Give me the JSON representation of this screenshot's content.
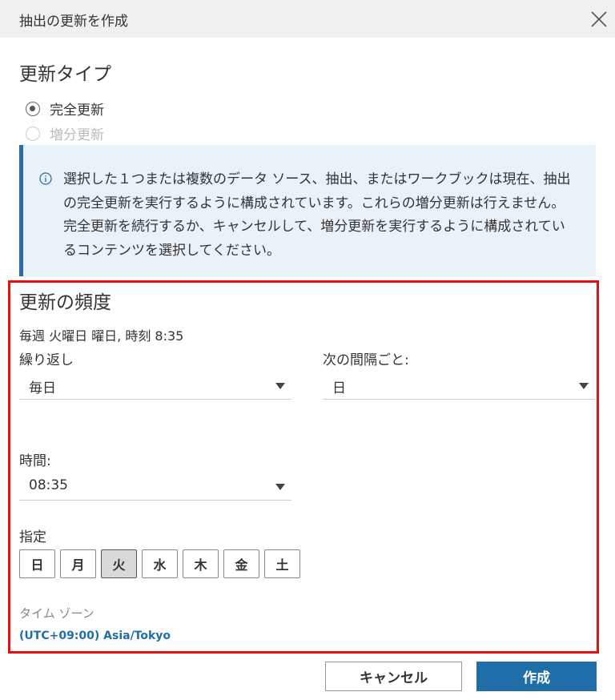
{
  "dialog": {
    "title": "抽出の更新を作成"
  },
  "refresh_type": {
    "heading": "更新タイプ",
    "options": [
      {
        "label": "完全更新",
        "selected": true,
        "enabled": true
      },
      {
        "label": "増分更新",
        "selected": false,
        "enabled": false
      }
    ]
  },
  "info_message": "選択した１つまたは複数のデータ ソース、抽出、またはワークブックは現在、抽出の完全更新を実行するように構成されています。これらの増分更新は行えません。完全更新を続行するか、キャンセルして、増分更新を実行するように構成されているコンテンツを選択してください。",
  "frequency": {
    "heading": "更新の頻度",
    "summary": "毎週 火曜日 曜日, 時刻 8:35",
    "repeat_label": "繰り返し",
    "repeat_value": "毎日",
    "interval_label": "次の間隔ごと:",
    "interval_value": "日",
    "time_label": "時間:",
    "time_value": "08:35",
    "on_label": "指定",
    "days": [
      {
        "label": "日",
        "selected": false
      },
      {
        "label": "月",
        "selected": false
      },
      {
        "label": "火",
        "selected": true
      },
      {
        "label": "水",
        "selected": false
      },
      {
        "label": "木",
        "selected": false
      },
      {
        "label": "金",
        "selected": false
      },
      {
        "label": "土",
        "selected": false
      }
    ],
    "timezone_label": "タイム ゾーン",
    "timezone_value": "(UTC+09:00) Asia/Tokyo"
  },
  "buttons": {
    "cancel": "キャンセル",
    "create": "作成"
  },
  "colors": {
    "accent": "#1f6ea8",
    "highlight_border": "#e01010",
    "info_bg": "#eaf2f9"
  }
}
